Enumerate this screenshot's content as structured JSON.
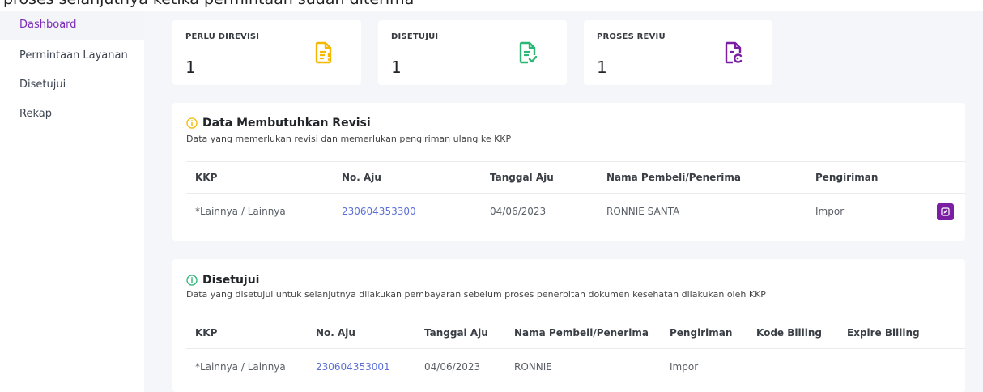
{
  "top_text": "proses selanjutnya ketika permintaan sudah diterima",
  "sidebar": {
    "items": [
      {
        "label": "Dashboard",
        "active": true
      },
      {
        "label": "Permintaan Layanan",
        "active": false
      },
      {
        "label": "Disetujui",
        "active": false
      },
      {
        "label": "Rekap",
        "active": false
      }
    ]
  },
  "stats": [
    {
      "label": "PERLU DIREVISI",
      "value": "1",
      "icon": "file-exclamation-icon",
      "color": "#f5b800"
    },
    {
      "label": "DISETUJUI",
      "value": "1",
      "icon": "file-check-icon",
      "color": "#2bb673"
    },
    {
      "label": "PROSES REVIU",
      "value": "1",
      "icon": "file-sync-icon",
      "color": "#7b1fa2"
    }
  ],
  "revisi": {
    "title": "Data Membutuhkan Revisi",
    "subtitle": "Data yang memerlukan revisi dan memerlukan pengiriman ulang ke KKP",
    "icon_color": "#f5b800",
    "columns": [
      "KKP",
      "No. Aju",
      "Tanggal Aju",
      "Nama Pembeli/Penerima",
      "Pengiriman"
    ],
    "rows": [
      {
        "kkp": "*Lainnya / Lainnya",
        "no_aju": "230604353300",
        "tanggal": "04/06/2023",
        "nama": "RONNIE SANTA",
        "pengiriman": "Impor"
      }
    ]
  },
  "disetujui": {
    "title": "Disetujui",
    "subtitle": "Data yang disetujui untuk selanjutnya dilakukan pembayaran sebelum proses penerbitan dokumen kesehatan dilakukan oleh KKP",
    "icon_color": "#2bb673",
    "columns": [
      "KKP",
      "No. Aju",
      "Tanggal Aju",
      "Nama Pembeli/Penerima",
      "Pengiriman",
      "Kode Billing",
      "Expire Billing"
    ],
    "rows": [
      {
        "kkp": "*Lainnya / Lainnya",
        "no_aju": "230604353001",
        "tanggal": "04/06/2023",
        "nama": "RONNIE",
        "pengiriman": "Impor",
        "kode_billing": "",
        "expire_billing": ""
      }
    ]
  },
  "colors": {
    "accent": "#7b2bb5",
    "link": "#5b6fd6",
    "background": "#f5f6fa"
  }
}
